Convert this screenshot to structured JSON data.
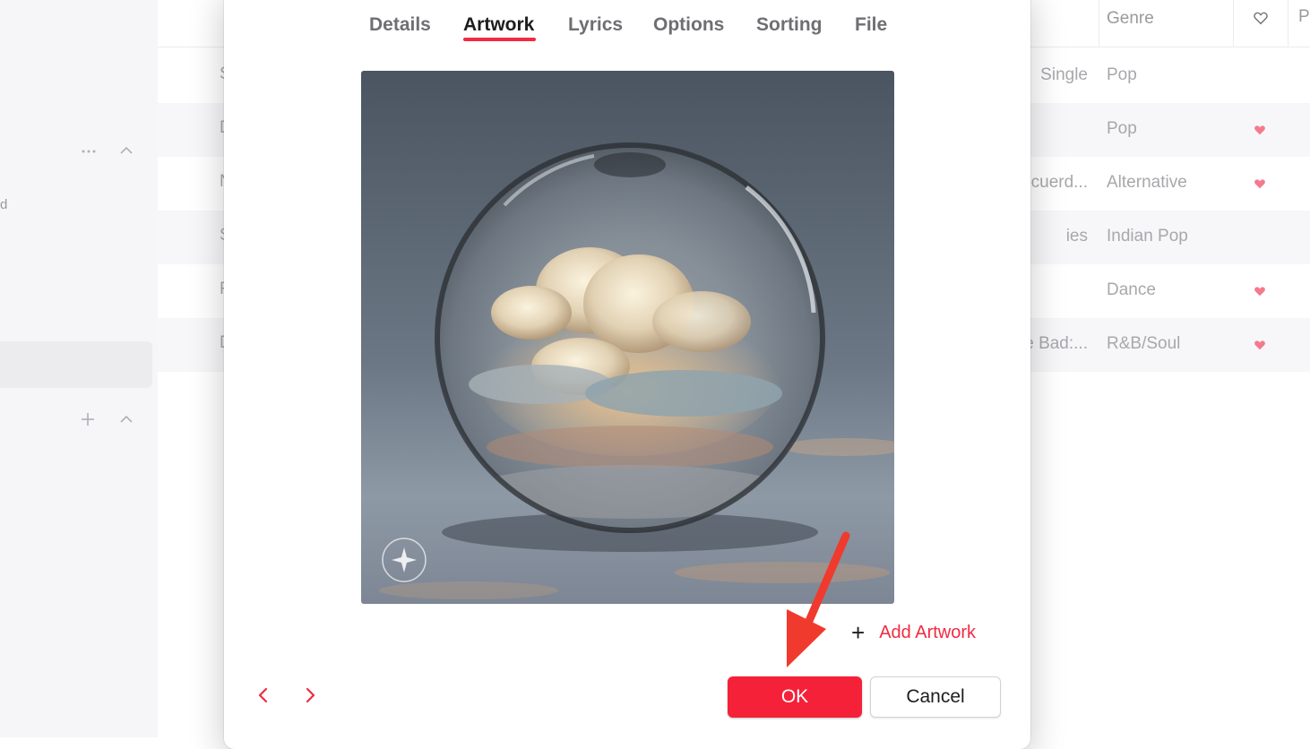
{
  "sidebar": {
    "fragment_text": "d",
    "more_icon": "ellipsis-icon",
    "collapse_icon": "chevron-up-icon",
    "add_icon": "plus-icon"
  },
  "table": {
    "genre_header": "Genre",
    "loved_header_icon": "heart-outline-icon",
    "partial_header": "P",
    "rows": [
      {
        "title_letter": "S",
        "album": "Single",
        "genre": "Pop",
        "loved": false
      },
      {
        "title_letter": "D",
        "album": "",
        "genre": "Pop",
        "loved": true
      },
      {
        "title_letter": "N",
        "album": "cuerd...",
        "genre": "Alternative",
        "loved": true
      },
      {
        "title_letter": "S",
        "album": "ies",
        "genre": "Indian Pop",
        "loved": false
      },
      {
        "title_letter": "F",
        "album": "",
        "genre": "Dance",
        "loved": true
      },
      {
        "title_letter": "D",
        "album": "e Bad:...",
        "genre": "R&B/Soul",
        "loved": true
      }
    ],
    "heart_color": "#f47a8c"
  },
  "dialog": {
    "tabs": [
      {
        "label": "Details"
      },
      {
        "label": "Artwork"
      },
      {
        "label": "Lyrics"
      },
      {
        "label": "Options"
      },
      {
        "label": "Sorting"
      },
      {
        "label": "File"
      }
    ],
    "active_tab": "Artwork",
    "artwork_badge_icon": "imagined-with-ai-badge-icon",
    "add_artwork_label": "Add Artwork",
    "prev_icon": "chevron-left-icon",
    "next_icon": "chevron-right-icon",
    "ok_label": "OK",
    "cancel_label": "Cancel"
  },
  "colors": {
    "accent": "#f22a42",
    "annotation_arrow": "#f03a2e"
  }
}
